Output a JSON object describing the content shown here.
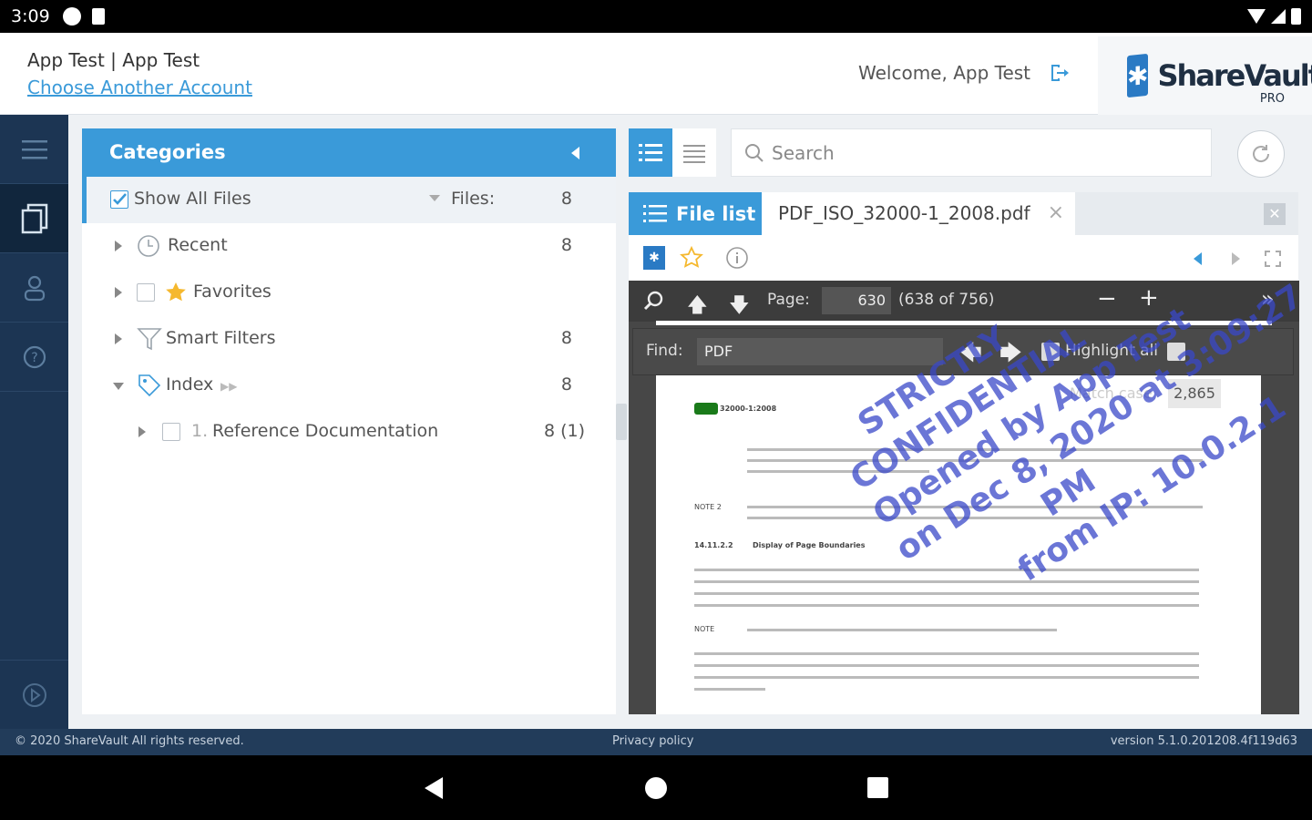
{
  "status_bar": {
    "time": "3:09"
  },
  "header": {
    "account_name": "App Test | App Test",
    "choose_account": "Choose Another Account",
    "welcome": "Welcome, App Test",
    "logo_text": "ShareVault",
    "logo_sub": "PRO"
  },
  "categories": {
    "title": "Categories",
    "show_all": {
      "label": "Show All Files",
      "files_label": "Files:",
      "count": "8"
    },
    "items": [
      {
        "label": "Recent",
        "count": "8"
      },
      {
        "label": "Favorites",
        "count": ""
      },
      {
        "label": "Smart Filters",
        "count": "8"
      },
      {
        "label": "Index",
        "count": "8"
      }
    ],
    "subitem": {
      "number": "1.",
      "label": "Reference Documentation",
      "count": "8 (1)"
    }
  },
  "search": {
    "placeholder": "Search"
  },
  "tabs": {
    "file_list": "File list",
    "document": "PDF_ISO_32000-1_2008.pdf"
  },
  "pdf": {
    "page_label": "Page:",
    "page_value": "630",
    "page_info": "(638 of 756)",
    "find_label": "Find:",
    "find_value": "PDF",
    "highlight_all": "Highlight all",
    "match_case": "Match case",
    "match_count": "2,865",
    "header_ref": "32000-1:2008",
    "section": "14.11.2.2",
    "section_title": "Display of Page Boundaries",
    "note2": "NOTE 2",
    "note": "NOTE",
    "watermark": [
      "STRICTLY",
      "CONFIDENTIAL",
      "Opened by App Test",
      "on Dec 8, 2020 at 3:09:27",
      "PM",
      "from IP: 10.0.2.1"
    ]
  },
  "footer": {
    "copyright": "© 2020 ShareVault All rights reserved.",
    "privacy": "Privacy policy",
    "version": "version 5.1.0.201208.4f119d63"
  },
  "colors": {
    "accent": "#3a9ad9",
    "rail": "#1c3553",
    "footer": "#223c5a"
  }
}
